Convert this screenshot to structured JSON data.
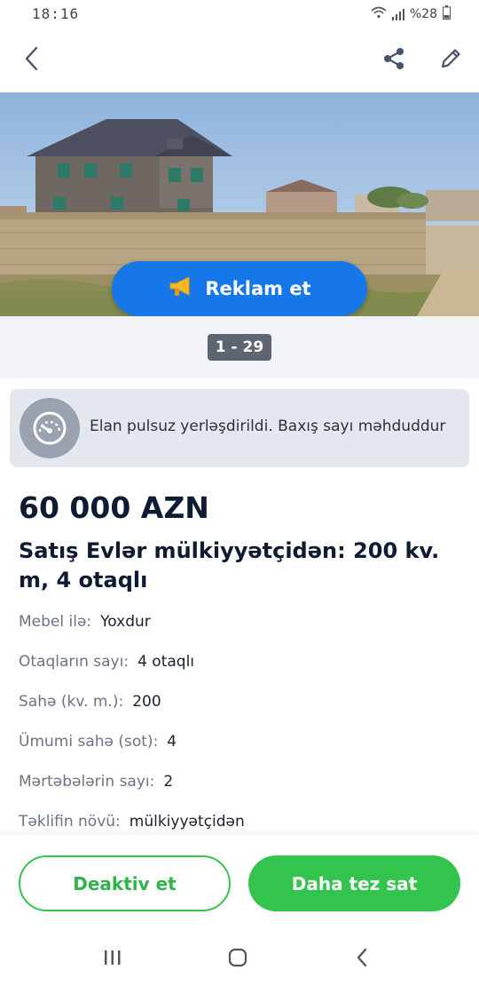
{
  "status_bar": {
    "time": "18:16",
    "battery": "%28"
  },
  "header": {
    "back_icon": "chevron-left-icon",
    "share_icon": "share-icon",
    "edit_icon": "pencil-icon"
  },
  "gallery": {
    "promo_label": "Reklam et",
    "promo_icon": "megaphone-icon",
    "counter": "1 - 29"
  },
  "notice": {
    "icon": "speedometer-icon",
    "text": "Elan pulsuz yerləşdirildi. Baxış sayı məhduddur"
  },
  "listing": {
    "price": "60 000 AZN",
    "title": "Satış Evlər mülkiyyətçidən: 200 kv. m, 4 otaqlı",
    "details": [
      {
        "label": "Mebel ilə:",
        "value": "Yoxdur"
      },
      {
        "label": "Otaqların sayı:",
        "value": "4 otaqlı"
      },
      {
        "label": "Sahə  (kv. m.):",
        "value": "200"
      },
      {
        "label": "Ümumi sahə (sot):",
        "value": "4"
      },
      {
        "label": "Mərtəbələrin sayı:",
        "value": "2"
      },
      {
        "label": "Təklifin növü:",
        "value": "mülkiyyətçidən"
      }
    ]
  },
  "actions": {
    "deactivate_label": "Deaktiv et",
    "sell_faster_label": "Daha tez sat"
  },
  "colors": {
    "accent_blue": "#1677e8",
    "accent_green": "#33c44e",
    "text_dark": "#0f1a33"
  }
}
